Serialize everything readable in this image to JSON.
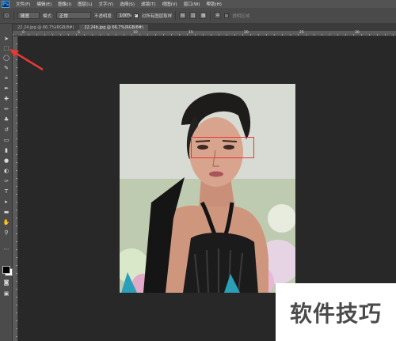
{
  "app": {
    "logo": "Ps"
  },
  "menu": {
    "items": [
      "文件(F)",
      "编辑(E)",
      "图像(I)",
      "图层(L)",
      "文字(Y)",
      "选择(S)",
      "滤镜(T)",
      "视图(V)",
      "窗口(W)",
      "帮助(H)"
    ]
  },
  "options": {
    "preset_value": "随意",
    "mode_label": "模式:",
    "mode_value": "正常",
    "opacity_label": "不透明度:",
    "opacity_value": "100%",
    "sample_label": "对所有图层取样",
    "transparent_label": "透明区域",
    "checked_mark": "✓"
  },
  "tabs": [
    {
      "label": "22.24.jpg @ 66.7%(RGB/8#)",
      "active": false
    },
    {
      "label": "22.24b.jpg @ 66.7%(RGB/8#)",
      "active": true
    }
  ],
  "ruler": {
    "top_numbers": [
      "0",
      "5",
      "10",
      "15",
      "20",
      "25",
      "30"
    ]
  },
  "tools": [
    "move-icon",
    "marquee-icon",
    "lasso-icon",
    "quick-select-icon",
    "crop-icon",
    "eyedropper-icon",
    "healing-icon",
    "brush-icon",
    "clone-stamp-icon",
    "history-brush-icon",
    "eraser-icon",
    "gradient-icon",
    "blur-icon",
    "dodge-icon",
    "pen-icon",
    "type-icon",
    "path-select-icon",
    "shape-icon",
    "hand-icon",
    "zoom-icon"
  ],
  "colors": {
    "selection": "#e53935",
    "arrow": "#e53935",
    "foreground": "#000000",
    "background": "#ffffff"
  },
  "watermark": {
    "text": "软件技巧"
  }
}
